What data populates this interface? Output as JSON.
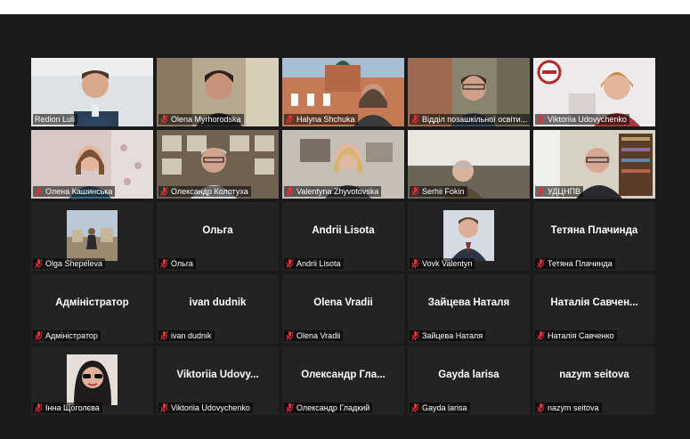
{
  "colors": {
    "stage": "#1a1a1a",
    "tile": "#232323",
    "active_border": "#c8e06a",
    "muted_icon": "#e0333a"
  },
  "participants": [
    {
      "name": "Redion Luli",
      "video": true,
      "active": true
    },
    {
      "name": "Olena  Myrhorodska",
      "video": true
    },
    {
      "name": "Halyna Shchuka",
      "video": true
    },
    {
      "name": "Відділ позашкільної освіти...",
      "video": true
    },
    {
      "name": "Viktoriia Udovychenko",
      "video": true
    },
    {
      "name": "Олена Кашинська",
      "video": true
    },
    {
      "name": "Олександр Колотуха",
      "video": true
    },
    {
      "name": "Valentyna Zhyvotovska",
      "video": true
    },
    {
      "name": "Serhii Fokin",
      "video": true
    },
    {
      "name": "УДЦНПВ",
      "video": true
    },
    {
      "name": "Olga Shepeleva",
      "avatar": true
    },
    {
      "name": "Ольга",
      "display": "Ольга"
    },
    {
      "name": "Andrii Lisota",
      "display": "Andrii Lisota"
    },
    {
      "name": "Vovk Valentyn",
      "avatar": true
    },
    {
      "name": "Тетяна Плачинда",
      "display": "Тетяна Плачинда"
    },
    {
      "name": "Адміністратор",
      "display": "Адміністратор"
    },
    {
      "name": "ivan dudnik",
      "display": "ivan dudnik"
    },
    {
      "name": "Olena Vradii",
      "display": "Olena Vradii"
    },
    {
      "name": "Зайцева Наталя",
      "display": "Зайцева Наталя"
    },
    {
      "name": "Наталія Савченко",
      "display": "Наталія  Савчен..."
    },
    {
      "name": "Інна Щоголєва",
      "avatar": true
    },
    {
      "name": "Viktoriia Udovychenko",
      "display": "Viktoriia  Udovy..."
    },
    {
      "name": "Олександр Гладкий",
      "display": "Олександр  Гла..."
    },
    {
      "name": "Gayda larisa",
      "display": "Gayda larisa"
    },
    {
      "name": "nazym seitova",
      "display": "nazym seitova"
    }
  ]
}
